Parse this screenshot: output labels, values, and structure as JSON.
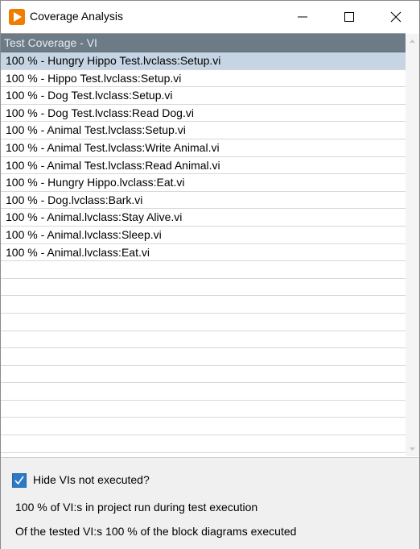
{
  "window": {
    "title": "Coverage Analysis"
  },
  "list": {
    "header": "Test Coverage - VI",
    "rows": [
      "100 % - Hungry Hippo Test.lvclass:Setup.vi",
      "100 % - Hippo Test.lvclass:Setup.vi",
      "100 % - Dog Test.lvclass:Setup.vi",
      "100 % - Dog Test.lvclass:Read Dog.vi",
      "100 % - Animal Test.lvclass:Setup.vi",
      "100 % - Animal Test.lvclass:Write Animal.vi",
      "100 % - Animal Test.lvclass:Read Animal.vi",
      "100 % - Hungry Hippo.lvclass:Eat.vi",
      "100 % - Dog.lvclass:Bark.vi",
      "100 % - Animal.lvclass:Stay Alive.vi",
      "100 % - Animal.lvclass:Sleep.vi",
      "100 % - Animal.lvclass:Eat.vi"
    ],
    "selected_index": 0
  },
  "footer": {
    "hide_checkbox_label": "Hide VIs not executed?",
    "hide_checked": true,
    "stat_vis_run": "100 % of VI:s in project run during test execution",
    "stat_block_diagrams": "Of the tested VI:s 100 % of the block diagrams executed"
  }
}
